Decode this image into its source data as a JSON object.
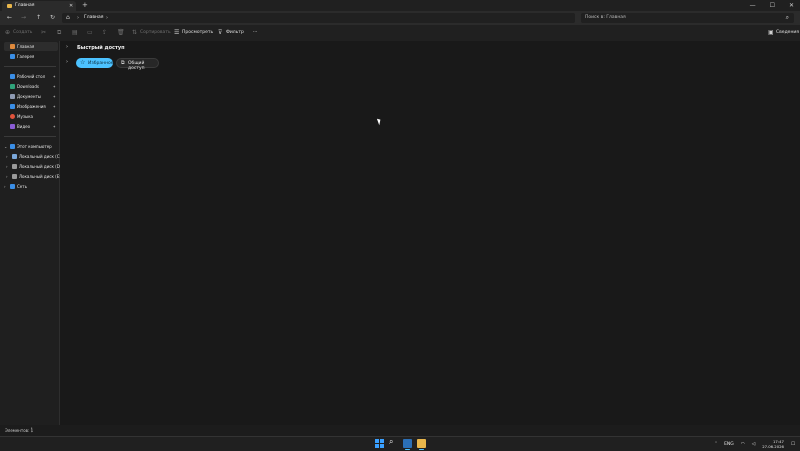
{
  "window": {
    "tab_title": "Главная",
    "tab_close": "✕",
    "new_tab": "+",
    "controls": [
      "—",
      "☐",
      "✕"
    ]
  },
  "navigation": {
    "back": "←",
    "forward": "→",
    "up": "↑",
    "refresh": "↻",
    "breadcrumb": [
      "Главная"
    ],
    "search_placeholder": "Поиск в: Главная"
  },
  "command_bar": {
    "create": "Создать",
    "sort": "Сортировать",
    "view": "Просмотреть",
    "filter": "Фильтр",
    "more": "···",
    "details": "Сведения"
  },
  "sidebar": {
    "top_items": [
      {
        "label": "Главная",
        "icon": "home-icon",
        "color": "#e08a3c",
        "active": true
      },
      {
        "label": "Галерея",
        "icon": "gallery-icon",
        "color": "#3a8ee6",
        "active": false
      }
    ],
    "pinned": [
      {
        "label": "Рабочий стол",
        "icon": "desktop-icon",
        "color": "#3a8ee6"
      },
      {
        "label": "Downloads",
        "icon": "downloads-icon",
        "color": "#2fa37a"
      },
      {
        "label": "Документы",
        "icon": "documents-icon",
        "color": "#8f9bb3"
      },
      {
        "label": "Изображения",
        "icon": "pictures-icon",
        "color": "#3a8ee6"
      },
      {
        "label": "Музыка",
        "icon": "music-icon",
        "color": "#e0533c"
      },
      {
        "label": "Видео",
        "icon": "videos-icon",
        "color": "#8a5cd6"
      }
    ],
    "pin_glyph": "📌",
    "this_pc": "Этот компьютер",
    "drives": [
      "Локальный диск (C:)",
      "Локальный диск (D:)",
      "Локальный диск (E:)"
    ],
    "network": "Сеть"
  },
  "main": {
    "quick_access_title": "Быстрый доступ",
    "favorites_pill": "Избранное",
    "shared_pill": "Общий доступ"
  },
  "status_bar": {
    "items_count": "Элементов: 1"
  },
  "taskbar": {
    "language": "ENG",
    "time": "17:47",
    "date": "27.06.2026"
  }
}
